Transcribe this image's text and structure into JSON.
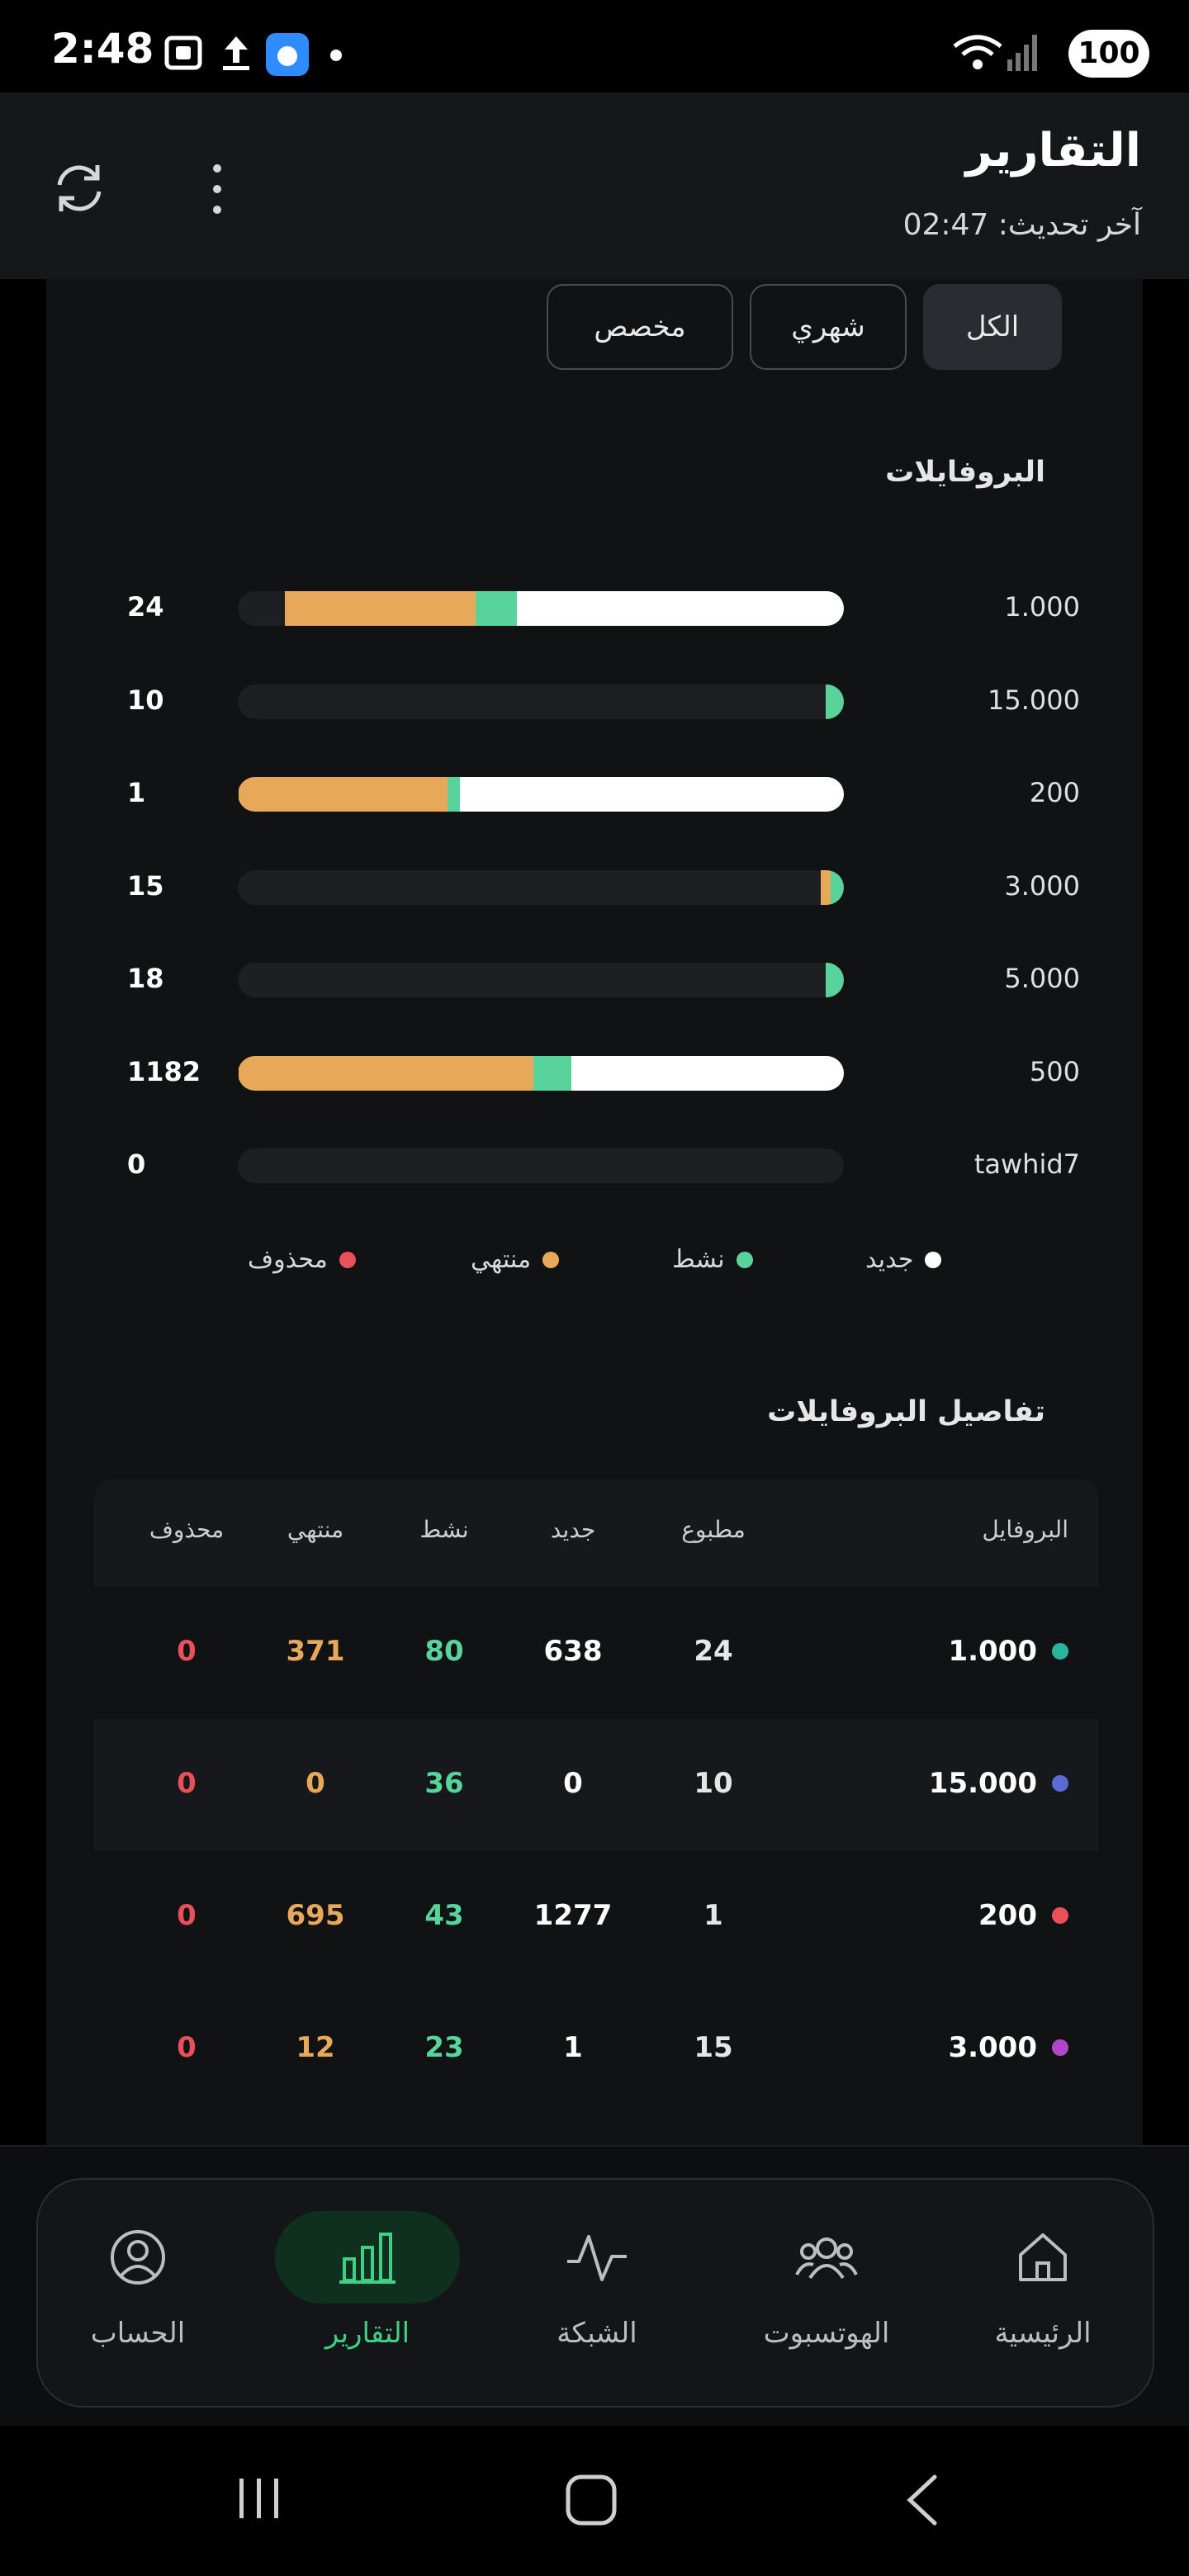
{
  "status_bar": {
    "time": "2:48",
    "battery": "100"
  },
  "header": {
    "title": "التقارير",
    "last_update": "آخر تحديث: 02:47"
  },
  "filters": [
    {
      "label": "الكل",
      "active": true
    },
    {
      "label": "شهري",
      "active": false
    },
    {
      "label": "مخصص",
      "active": false
    }
  ],
  "profiles_section": {
    "title": "البروفايلات"
  },
  "profile_bars": [
    {
      "name": "1.000",
      "count": "24",
      "expired": 0.315,
      "active": 0.068,
      "new": 0.54
    },
    {
      "name": "15.000",
      "count": "10",
      "expired": 0.0,
      "active": 0.03,
      "new": 0.0
    },
    {
      "name": "200",
      "count": "1",
      "expired": 0.345,
      "active": 0.021,
      "new": 0.634
    },
    {
      "name": "3.000",
      "count": "15",
      "expired": 0.016,
      "active": 0.022,
      "new": 0.0
    },
    {
      "name": "5.000",
      "count": "18",
      "expired": 0.0,
      "active": 0.03,
      "new": 0.0
    },
    {
      "name": "500",
      "count": "1182",
      "expired": 0.487,
      "active": 0.063,
      "new": 0.45
    },
    {
      "name": "tawhid7",
      "count": "0",
      "expired": 0.0,
      "active": 0.0,
      "new": 0.0
    }
  ],
  "legend": [
    {
      "label": "جديد",
      "color": "#ffffff"
    },
    {
      "label": "نشط",
      "color": "#58d39b"
    },
    {
      "label": "منتهي",
      "color": "#e7a85a"
    },
    {
      "label": "محذوف",
      "color": "#e8505a"
    }
  ],
  "details_section": {
    "title": "تفاصيل البروفايلات"
  },
  "table": {
    "headers": {
      "profile": "البروفايل",
      "printed": "مطبوع",
      "new": "جديد",
      "active": "نشط",
      "expired": "منتهي",
      "deleted": "محذوف"
    },
    "rows": [
      {
        "name": "1.000",
        "dot": "#2bb5a0",
        "printed": "24",
        "new": "638",
        "active": "80",
        "expired": "371",
        "deleted": "0"
      },
      {
        "name": "15.000",
        "dot": "#5b6bd6",
        "printed": "10",
        "new": "0",
        "active": "36",
        "expired": "0",
        "deleted": "0"
      },
      {
        "name": "200",
        "dot": "#e8505a",
        "printed": "1",
        "new": "1277",
        "active": "43",
        "expired": "695",
        "deleted": "0"
      },
      {
        "name": "3.000",
        "dot": "#b046c9",
        "printed": "15",
        "new": "1",
        "active": "23",
        "expired": "12",
        "deleted": "0"
      }
    ]
  },
  "nav": [
    {
      "label": "الرئيسية",
      "icon": "home-icon"
    },
    {
      "label": "الهوتسبوت",
      "icon": "users-icon"
    },
    {
      "label": "الشبكة",
      "icon": "pulse-icon"
    },
    {
      "label": "التقارير",
      "icon": "chart-icon",
      "active": true
    },
    {
      "label": "الحساب",
      "icon": "account-icon"
    }
  ],
  "colors": {
    "accent": "#3fcf85",
    "new": "#ffffff",
    "active": "#58d39b",
    "expired": "#e7a85a",
    "deleted": "#e8505a"
  }
}
